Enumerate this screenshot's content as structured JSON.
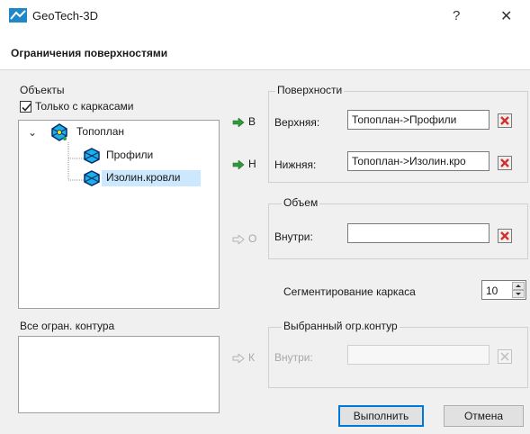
{
  "window": {
    "title": "GeoTech-3D",
    "help": "?",
    "close": "✕"
  },
  "dialog": {
    "title": "Ограничения поверхностями"
  },
  "objects": {
    "group_label": "Объекты",
    "only_frames_label": "Только с каркасами",
    "only_frames_checked": true,
    "tree": {
      "root": "Топоплан",
      "children": [
        "Профили",
        "Изолин.кровли"
      ],
      "selected": "Изолин.кровли"
    }
  },
  "contours": {
    "group_label": "Все огран. контура"
  },
  "arrows": {
    "upper": "В",
    "lower": "Н",
    "volume": "О",
    "contour": "К"
  },
  "surfaces": {
    "group_label": "Поверхности",
    "upper_label": "Верхняя:",
    "upper_value": "Топоплан->Профили",
    "lower_label": "Нижняя:",
    "lower_value": "Топоплан->Изолин.кро"
  },
  "volume": {
    "group_label": "Объем",
    "inside_label": "Внутри:",
    "inside_value": ""
  },
  "segmentation": {
    "label": "Сегментирование каркаса",
    "value": "10"
  },
  "selected_contour": {
    "group_label": "Выбранный огр.контур",
    "inside_label": "Внутри:",
    "inside_value": ""
  },
  "buttons": {
    "run": "Выполнить",
    "cancel": "Отмена"
  },
  "colors": {
    "accent": "#0078d7",
    "selection": "#cce8ff",
    "arrow_green": "#2e9b3a",
    "clear_red": "#d32f2f"
  }
}
